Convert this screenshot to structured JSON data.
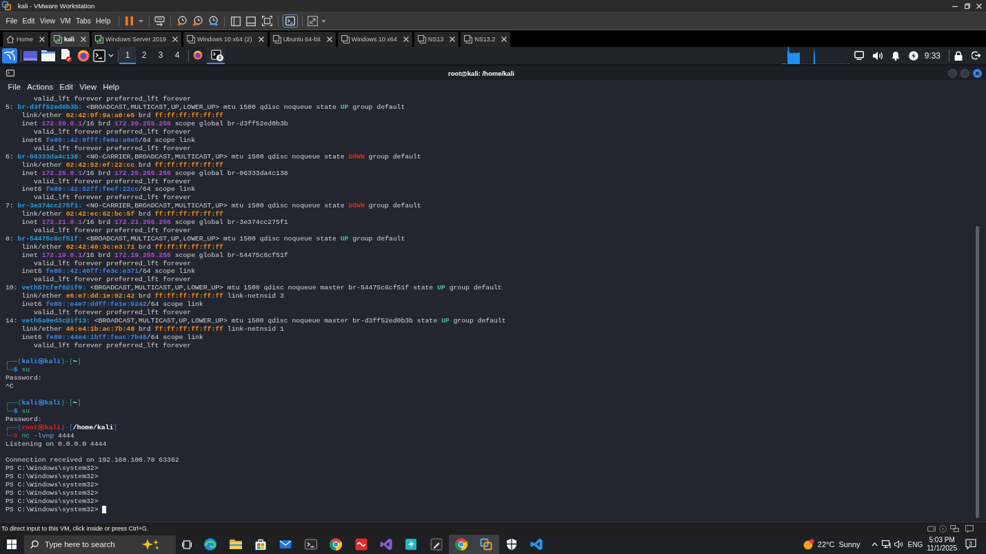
{
  "vmware": {
    "title": "kali - VMware Workstation",
    "menu": [
      "File",
      "Edit",
      "View",
      "VM",
      "Tabs",
      "Help"
    ],
    "console_view_on": true,
    "tabs": [
      {
        "label": "Home",
        "kind": "home",
        "selected": false
      },
      {
        "label": "kali",
        "kind": "running",
        "selected": true
      },
      {
        "label": "Windows Server 2019",
        "kind": "running",
        "selected": false
      },
      {
        "label": "Windows 10 x64 (2)",
        "kind": "stopped",
        "selected": false
      },
      {
        "label": "Ubuntu 64-bit",
        "kind": "stopped",
        "selected": false
      },
      {
        "label": "Windows 10 x64",
        "kind": "stopped",
        "selected": false
      },
      {
        "label": "NS13",
        "kind": "stopped",
        "selected": false
      },
      {
        "label": "NS13.2",
        "kind": "stopped",
        "selected": false
      }
    ]
  },
  "kali_panel": {
    "workspaces": [
      {
        "label": "1",
        "selected": true
      },
      {
        "label": "2",
        "selected": false
      },
      {
        "label": "3",
        "selected": false
      },
      {
        "label": "4",
        "selected": false
      }
    ],
    "tasks": [
      {
        "kind": "browser",
        "selected": false
      },
      {
        "kind": "terminal",
        "selected": true,
        "badge": "2"
      }
    ],
    "clock": "9:33"
  },
  "terminal": {
    "title": "root@kali: /home/kali",
    "menu": [
      "File",
      "Actions",
      "Edit",
      "View",
      "Help"
    ],
    "lines": [
      {
        "kind": "deep-indent",
        "segments": [
          {
            "kind": "plain",
            "text": "valid_lft forever preferred_lft forever"
          }
        ]
      },
      {
        "kind": "flush",
        "segments": [
          {
            "kind": "plain",
            "text": "5: "
          },
          {
            "kind": "iface",
            "text": "br-d3ff52ed0b3b:"
          },
          {
            "kind": "plain",
            "text": " <BROADCAST,MULTICAST,UP,LOWER_UP> mtu 1500 qdisc noqueue state "
          },
          {
            "kind": "up",
            "text": "UP"
          },
          {
            "kind": "plain",
            "text": " group default"
          }
        ]
      },
      {
        "kind": "indent",
        "segments": [
          {
            "kind": "plain",
            "text": "link/ether "
          },
          {
            "kind": "mac",
            "text": "02:42:9f:9a:a0:e5"
          },
          {
            "kind": "plain",
            "text": " brd "
          },
          {
            "kind": "mac",
            "text": "ff:ff:ff:ff:ff:ff"
          }
        ]
      },
      {
        "kind": "indent",
        "segments": [
          {
            "kind": "plain",
            "text": "inet "
          },
          {
            "kind": "ipv4",
            "text": "172.20.0.1"
          },
          {
            "kind": "plain",
            "text": "/16 brd "
          },
          {
            "kind": "ipv4",
            "text": "172.20.255.255"
          },
          {
            "kind": "plain",
            "text": " scope global br-d3ff52ed0b3b"
          }
        ]
      },
      {
        "kind": "deep-indent",
        "segments": [
          {
            "kind": "plain",
            "text": "valid_lft forever preferred_lft forever"
          }
        ]
      },
      {
        "kind": "indent",
        "segments": [
          {
            "kind": "plain",
            "text": "inet6 "
          },
          {
            "kind": "ipv6",
            "text": "fe80::42:9fff:fe9a:a0e5"
          },
          {
            "kind": "plain",
            "text": "/64 scope link"
          }
        ]
      },
      {
        "kind": "deep-indent",
        "segments": [
          {
            "kind": "plain",
            "text": "valid_lft forever preferred_lft forever"
          }
        ]
      },
      {
        "kind": "flush",
        "segments": [
          {
            "kind": "plain",
            "text": "6: "
          },
          {
            "kind": "iface",
            "text": "br-06333da4c138:"
          },
          {
            "kind": "plain",
            "text": " <NO-CARRIER,BROADCAST,MULTICAST,UP> mtu 1500 qdisc noqueue state "
          },
          {
            "kind": "down",
            "text": "DOWN"
          },
          {
            "kind": "plain",
            "text": " group default"
          }
        ]
      },
      {
        "kind": "indent",
        "segments": [
          {
            "kind": "plain",
            "text": "link/ether "
          },
          {
            "kind": "mac",
            "text": "02:42:52:ef:22:cc"
          },
          {
            "kind": "plain",
            "text": " brd "
          },
          {
            "kind": "mac",
            "text": "ff:ff:ff:ff:ff:ff"
          }
        ]
      },
      {
        "kind": "indent",
        "segments": [
          {
            "kind": "plain",
            "text": "inet "
          },
          {
            "kind": "ipv4",
            "text": "172.25.0.1"
          },
          {
            "kind": "plain",
            "text": "/16 brd "
          },
          {
            "kind": "ipv4",
            "text": "172.25.255.255"
          },
          {
            "kind": "plain",
            "text": " scope global br-06333da4c138"
          }
        ]
      },
      {
        "kind": "deep-indent",
        "segments": [
          {
            "kind": "plain",
            "text": "valid_lft forever preferred_lft forever"
          }
        ]
      },
      {
        "kind": "indent",
        "segments": [
          {
            "kind": "plain",
            "text": "inet6 "
          },
          {
            "kind": "ipv6",
            "text": "fe80::42:52ff:feef:22cc"
          },
          {
            "kind": "plain",
            "text": "/64 scope link"
          }
        ]
      },
      {
        "kind": "deep-indent",
        "segments": [
          {
            "kind": "plain",
            "text": "valid_lft forever preferred_lft forever"
          }
        ]
      },
      {
        "kind": "flush",
        "segments": [
          {
            "kind": "plain",
            "text": "7: "
          },
          {
            "kind": "iface",
            "text": "br-3e374cc275f1:"
          },
          {
            "kind": "plain",
            "text": " <NO-CARRIER,BROADCAST,MULTICAST,UP> mtu 1500 qdisc noqueue state "
          },
          {
            "kind": "down",
            "text": "DOWN"
          },
          {
            "kind": "plain",
            "text": " group default"
          }
        ]
      },
      {
        "kind": "indent",
        "segments": [
          {
            "kind": "plain",
            "text": "link/ether "
          },
          {
            "kind": "mac",
            "text": "02:42:ec:62:bc:5f"
          },
          {
            "kind": "plain",
            "text": " brd "
          },
          {
            "kind": "mac",
            "text": "ff:ff:ff:ff:ff:ff"
          }
        ]
      },
      {
        "kind": "indent",
        "segments": [
          {
            "kind": "plain",
            "text": "inet "
          },
          {
            "kind": "ipv4",
            "text": "172.21.0.1"
          },
          {
            "kind": "plain",
            "text": "/16 brd "
          },
          {
            "kind": "ipv4",
            "text": "172.21.255.255"
          },
          {
            "kind": "plain",
            "text": " scope global br-3e374cc275f1"
          }
        ]
      },
      {
        "kind": "deep-indent",
        "segments": [
          {
            "kind": "plain",
            "text": "valid_lft forever preferred_lft forever"
          }
        ]
      },
      {
        "kind": "flush",
        "segments": [
          {
            "kind": "plain",
            "text": "8: "
          },
          {
            "kind": "iface",
            "text": "br-54475c6cf51f:"
          },
          {
            "kind": "plain",
            "text": " <BROADCAST,MULTICAST,UP,LOWER_UP> mtu 1500 qdisc noqueue state "
          },
          {
            "kind": "up",
            "text": "UP"
          },
          {
            "kind": "plain",
            "text": " group default"
          }
        ]
      },
      {
        "kind": "indent",
        "segments": [
          {
            "kind": "plain",
            "text": "link/ether "
          },
          {
            "kind": "mac",
            "text": "02:42:40:3c:e3:71"
          },
          {
            "kind": "plain",
            "text": " brd "
          },
          {
            "kind": "mac",
            "text": "ff:ff:ff:ff:ff:ff"
          }
        ]
      },
      {
        "kind": "indent",
        "segments": [
          {
            "kind": "plain",
            "text": "inet "
          },
          {
            "kind": "ipv4",
            "text": "172.19.0.1"
          },
          {
            "kind": "plain",
            "text": "/16 brd "
          },
          {
            "kind": "ipv4",
            "text": "172.19.255.255"
          },
          {
            "kind": "plain",
            "text": " scope global br-54475c6cf51f"
          }
        ]
      },
      {
        "kind": "deep-indent",
        "segments": [
          {
            "kind": "plain",
            "text": "valid_lft forever preferred_lft forever"
          }
        ]
      },
      {
        "kind": "indent",
        "segments": [
          {
            "kind": "plain",
            "text": "inet6 "
          },
          {
            "kind": "ipv6",
            "text": "fe80::42:40ff:fe3c:e371"
          },
          {
            "kind": "plain",
            "text": "/64 scope link"
          }
        ]
      },
      {
        "kind": "deep-indent",
        "segments": [
          {
            "kind": "plain",
            "text": "valid_lft forever preferred_lft forever"
          }
        ]
      },
      {
        "kind": "flush",
        "segments": [
          {
            "kind": "plain",
            "text": "10: "
          },
          {
            "kind": "iface",
            "text": "veth57cfef6@if9:"
          },
          {
            "kind": "plain",
            "text": " <BROADCAST,MULTICAST,UP,LOWER_UP> mtu 1500 qdisc noqueue master br-54475c6cf51f state "
          },
          {
            "kind": "up",
            "text": "UP"
          },
          {
            "kind": "plain",
            "text": " group default"
          }
        ]
      },
      {
        "kind": "indent",
        "segments": [
          {
            "kind": "plain",
            "text": "link/ether "
          },
          {
            "kind": "mac",
            "text": "e6:e7:dd:1e:92:42"
          },
          {
            "kind": "plain",
            "text": " brd "
          },
          {
            "kind": "mac",
            "text": "ff:ff:ff:ff:ff:ff"
          },
          {
            "kind": "plain",
            "text": " link-netnsid 3"
          }
        ]
      },
      {
        "kind": "indent",
        "segments": [
          {
            "kind": "plain",
            "text": "inet6 "
          },
          {
            "kind": "ipv6",
            "text": "fe80::e4e7:ddff:fe1e:9242"
          },
          {
            "kind": "plain",
            "text": "/64 scope link"
          }
        ]
      },
      {
        "kind": "deep-indent",
        "segments": [
          {
            "kind": "plain",
            "text": "valid_lft forever preferred_lft forever"
          }
        ]
      },
      {
        "kind": "flush",
        "segments": [
          {
            "kind": "plain",
            "text": "14: "
          },
          {
            "kind": "iface",
            "text": "veth5a9ed3c@if13:"
          },
          {
            "kind": "plain",
            "text": " <BROADCAST,MULTICAST,UP,LOWER_UP> mtu 1500 qdisc noqueue master br-d3ff52ed0b3b state "
          },
          {
            "kind": "up",
            "text": "UP"
          },
          {
            "kind": "plain",
            "text": " group default"
          }
        ]
      },
      {
        "kind": "indent",
        "segments": [
          {
            "kind": "plain",
            "text": "link/ether "
          },
          {
            "kind": "mac",
            "text": "46:e4:1b:ac:7b:48"
          },
          {
            "kind": "plain",
            "text": " brd "
          },
          {
            "kind": "mac",
            "text": "ff:ff:ff:ff:ff:ff"
          },
          {
            "kind": "plain",
            "text": " link-netnsid 1"
          }
        ]
      },
      {
        "kind": "indent",
        "segments": [
          {
            "kind": "plain",
            "text": "inet6 "
          },
          {
            "kind": "ipv6",
            "text": "fe80::44e4:1bff:feac:7b48"
          },
          {
            "kind": "plain",
            "text": "/64 scope link"
          }
        ]
      },
      {
        "kind": "deep-indent",
        "segments": [
          {
            "kind": "plain",
            "text": "valid_lft forever preferred_lft forever"
          }
        ]
      },
      {
        "kind": "blank"
      },
      {
        "kind": "flush",
        "segments": [
          {
            "kind": "frame",
            "text": "┌──("
          },
          {
            "kind": "user",
            "text": "kali㉿kali"
          },
          {
            "kind": "frame",
            "text": ")-["
          },
          {
            "kind": "path",
            "text": "~"
          },
          {
            "kind": "frame",
            "text": "]"
          }
        ]
      },
      {
        "kind": "flush",
        "segments": [
          {
            "kind": "frame",
            "text": "└─"
          },
          {
            "kind": "sign",
            "text": "$"
          },
          {
            "kind": "cmd",
            "text": " su"
          }
        ]
      },
      {
        "kind": "flush",
        "segments": [
          {
            "kind": "plain",
            "text": "Password:"
          }
        ]
      },
      {
        "kind": "flush",
        "segments": [
          {
            "kind": "plain",
            "text": "^C"
          }
        ]
      },
      {
        "kind": "blank"
      },
      {
        "kind": "flush",
        "segments": [
          {
            "kind": "frame",
            "text": "┌──("
          },
          {
            "kind": "user",
            "text": "kali㉿kali"
          },
          {
            "kind": "frame",
            "text": ")-["
          },
          {
            "kind": "path",
            "text": "~"
          },
          {
            "kind": "frame",
            "text": "]"
          }
        ]
      },
      {
        "kind": "flush",
        "segments": [
          {
            "kind": "frame",
            "text": "└─"
          },
          {
            "kind": "sign",
            "text": "$"
          },
          {
            "kind": "cmd",
            "text": " su"
          }
        ]
      },
      {
        "kind": "flush",
        "segments": [
          {
            "kind": "plain",
            "text": "Password:"
          }
        ]
      },
      {
        "kind": "flush",
        "segments": [
          {
            "kind": "frame-root",
            "text": "┌──("
          },
          {
            "kind": "root",
            "text": "root㉿kali"
          },
          {
            "kind": "frame-root",
            "text": ")-["
          },
          {
            "kind": "path",
            "text": "/home/kali"
          },
          {
            "kind": "frame-root",
            "text": "]"
          }
        ]
      },
      {
        "kind": "flush",
        "segments": [
          {
            "kind": "frame-root",
            "text": "└─"
          },
          {
            "kind": "sign-root",
            "text": "#"
          },
          {
            "kind": "cmd",
            "text": " nc"
          },
          {
            "kind": "arg",
            "text": " -lvnp"
          },
          {
            "kind": "plain",
            "text": " 4444"
          }
        ]
      },
      {
        "kind": "flush",
        "segments": [
          {
            "kind": "plain",
            "text": "Listening on 0.0.0.0 4444"
          }
        ]
      },
      {
        "kind": "blank"
      },
      {
        "kind": "flush",
        "segments": [
          {
            "kind": "plain",
            "text": "Connection received on 192.168.100.78 63362"
          }
        ]
      },
      {
        "kind": "flush",
        "segments": [
          {
            "kind": "plain",
            "text": "PS C:\\Windows\\system32>"
          }
        ]
      },
      {
        "kind": "flush",
        "segments": [
          {
            "kind": "plain",
            "text": "PS C:\\Windows\\system32>"
          }
        ]
      },
      {
        "kind": "flush",
        "segments": [
          {
            "kind": "plain",
            "text": "PS C:\\Windows\\system32>"
          }
        ]
      },
      {
        "kind": "flush",
        "segments": [
          {
            "kind": "plain",
            "text": "PS C:\\Windows\\system32>"
          }
        ]
      },
      {
        "kind": "flush",
        "segments": [
          {
            "kind": "plain",
            "text": "PS C:\\Windows\\system32>"
          }
        ]
      },
      {
        "kind": "flush",
        "segments": [
          {
            "kind": "plain",
            "text": "PS C:\\Windows\\system32>"
          }
        ],
        "cursor": true
      }
    ]
  },
  "status_bar": {
    "text": "To direct input to this VM, click inside or press Ctrl+G."
  },
  "taskbar": {
    "search": {
      "placeholder": "Type here to search"
    },
    "apps": [
      {
        "kind": "browser-wave",
        "active": false
      },
      {
        "kind": "folder",
        "active": false
      },
      {
        "kind": "store-bag",
        "active": false
      },
      {
        "kind": "mail",
        "active": false
      },
      {
        "kind": "terminal",
        "active": false
      },
      {
        "kind": "browser-ring",
        "active": false
      },
      {
        "kind": "wave-tile",
        "active": false
      },
      {
        "kind": "ribbon",
        "active": false
      },
      {
        "kind": "bolt-tile",
        "active": false
      },
      {
        "kind": "pen-tile",
        "active": false
      },
      {
        "kind": "browser-ring",
        "active": true
      },
      {
        "kind": "squares",
        "active": true
      },
      {
        "kind": "shield",
        "active": false
      },
      {
        "kind": "code-ribbon",
        "active": false
      }
    ],
    "weather": {
      "temperature": "22°C",
      "condition": "Sunny"
    },
    "language": "ENG",
    "time": "5:03 PM",
    "date": "11/1/2025",
    "notifications": "3"
  }
}
